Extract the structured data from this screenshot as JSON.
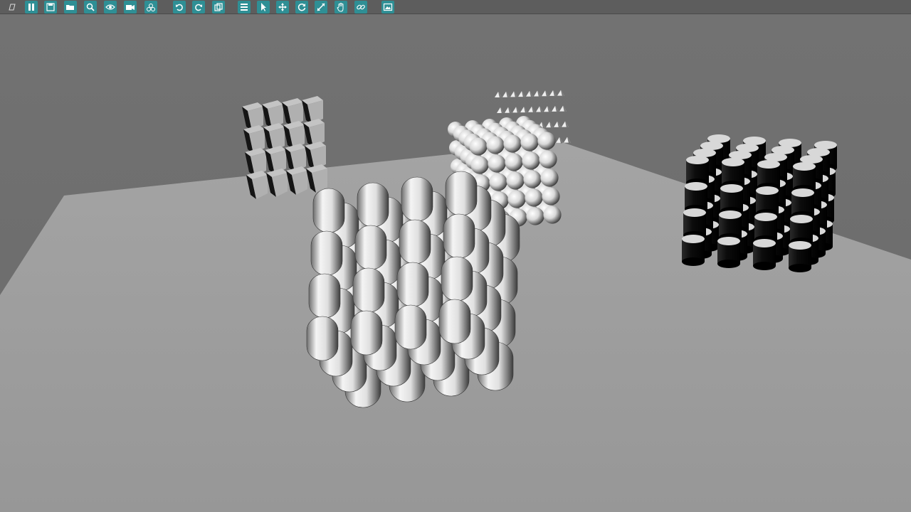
{
  "app": {
    "title": ""
  },
  "toolbar": {
    "buttons": [
      {
        "name": "new-scene-icon",
        "group": "file"
      },
      {
        "name": "pause-icon",
        "group": "file"
      },
      {
        "name": "save-icon",
        "group": "file"
      },
      {
        "name": "open-folder-icon",
        "group": "file"
      },
      {
        "name": "zoom-icon",
        "group": "view"
      },
      {
        "name": "eye-icon",
        "group": "view"
      },
      {
        "name": "camera-icon",
        "group": "view"
      },
      {
        "name": "spheres-icon",
        "group": "view"
      },
      {
        "name": "undo-icon",
        "group": "edit"
      },
      {
        "name": "redo-icon",
        "group": "edit"
      },
      {
        "name": "copy-icon",
        "group": "edit"
      },
      {
        "name": "list-icon",
        "group": "tools"
      },
      {
        "name": "select-arrow-icon",
        "group": "tools"
      },
      {
        "name": "move-icon",
        "group": "tools"
      },
      {
        "name": "rotate-icon",
        "group": "tools"
      },
      {
        "name": "scale-icon",
        "group": "tools"
      },
      {
        "name": "hand-icon",
        "group": "tools"
      },
      {
        "name": "link-icon",
        "group": "tools"
      },
      {
        "name": "image-icon",
        "group": "render"
      }
    ],
    "accent_color": "#2f8f95"
  },
  "scene": {
    "background_color": "#6f6f6f",
    "ground_color": "#9c9c9c",
    "objects": [
      {
        "name": "box-stack",
        "shape": "box",
        "color": "#b4b4b4"
      },
      {
        "name": "capsule-stack",
        "shape": "capsule",
        "color": "#e6e6e6"
      },
      {
        "name": "sphere-stack",
        "shape": "sphere",
        "color": "#dcdcdc"
      },
      {
        "name": "cone-stack",
        "shape": "cone",
        "color": "#e0e0e0"
      },
      {
        "name": "cylinder-stack",
        "shape": "cylinder",
        "color": "#111111"
      }
    ]
  }
}
